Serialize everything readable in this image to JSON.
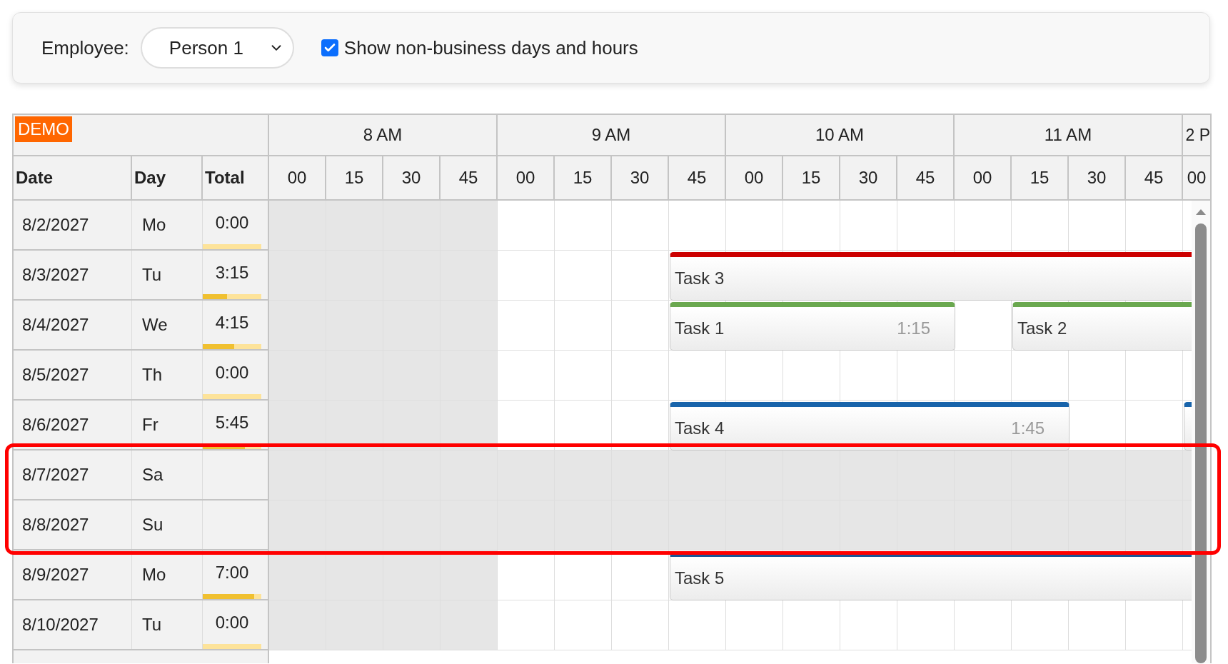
{
  "toolbar": {
    "employee_label": "Employee:",
    "employee": "Person 1",
    "show_non_business": {
      "label": "Show non-business days and hours",
      "checked": true
    }
  },
  "badge": "DEMO",
  "columns": [
    "Date",
    "Day",
    "Total"
  ],
  "hours": [
    {
      "label": "8 AM",
      "business": false,
      "partial": false,
      "slots": [
        "00",
        "15",
        "30",
        "45"
      ]
    },
    {
      "label": "9 AM",
      "business": true,
      "partial": false,
      "slots": [
        "00",
        "15",
        "30",
        "45"
      ]
    },
    {
      "label": "10 AM",
      "business": true,
      "partial": false,
      "slots": [
        "00",
        "15",
        "30",
        "45"
      ]
    },
    {
      "label": "11 AM",
      "business": true,
      "partial": false,
      "slots": [
        "00",
        "15",
        "30",
        "45"
      ]
    },
    {
      "label": "2 P",
      "business": true,
      "partial": true,
      "slots": [
        "00"
      ]
    }
  ],
  "rows": [
    {
      "date": "8/2/2027",
      "day": "Mo",
      "total": "0:00",
      "level": 0,
      "business": true,
      "highlighted": false
    },
    {
      "date": "8/3/2027",
      "day": "Tu",
      "total": "3:15",
      "level": 0.41,
      "business": true,
      "highlighted": false,
      "tasks": [
        {
          "name": "Task 3",
          "color": "#cc0000"
        }
      ]
    },
    {
      "date": "8/4/2027",
      "day": "We",
      "total": "4:15",
      "level": 0.54,
      "business": true,
      "highlighted": false,
      "tasks": [
        {
          "name": "Task 1",
          "duration": "1:15",
          "color": "#6aa84f"
        },
        {
          "name": "Task 2",
          "color": "#6aa84f"
        }
      ]
    },
    {
      "date": "8/5/2027",
      "day": "Th",
      "total": "0:00",
      "level": 0,
      "business": true,
      "highlighted": false
    },
    {
      "date": "8/6/2027",
      "day": "Fr",
      "total": "5:45",
      "level": 0.72,
      "business": true,
      "highlighted": false,
      "tasks": [
        {
          "name": "Task 4",
          "duration": "1:45",
          "color": "#1864ab"
        },
        {
          "color": "#1864ab"
        }
      ]
    },
    {
      "date": "8/7/2027",
      "day": "Sa",
      "business": false,
      "highlighted": true
    },
    {
      "date": "8/8/2027",
      "day": "Su",
      "business": false,
      "highlighted": true
    },
    {
      "date": "8/9/2027",
      "day": "Mo",
      "total": "7:00",
      "level": 0.875,
      "business": true,
      "highlighted": false,
      "tasks": [
        {
          "name": "Task 5",
          "color": "#1c5696"
        }
      ]
    },
    {
      "date": "8/10/2027",
      "day": "Tu",
      "total": "0:00",
      "level": 0,
      "business": true,
      "highlighted": false
    }
  ]
}
